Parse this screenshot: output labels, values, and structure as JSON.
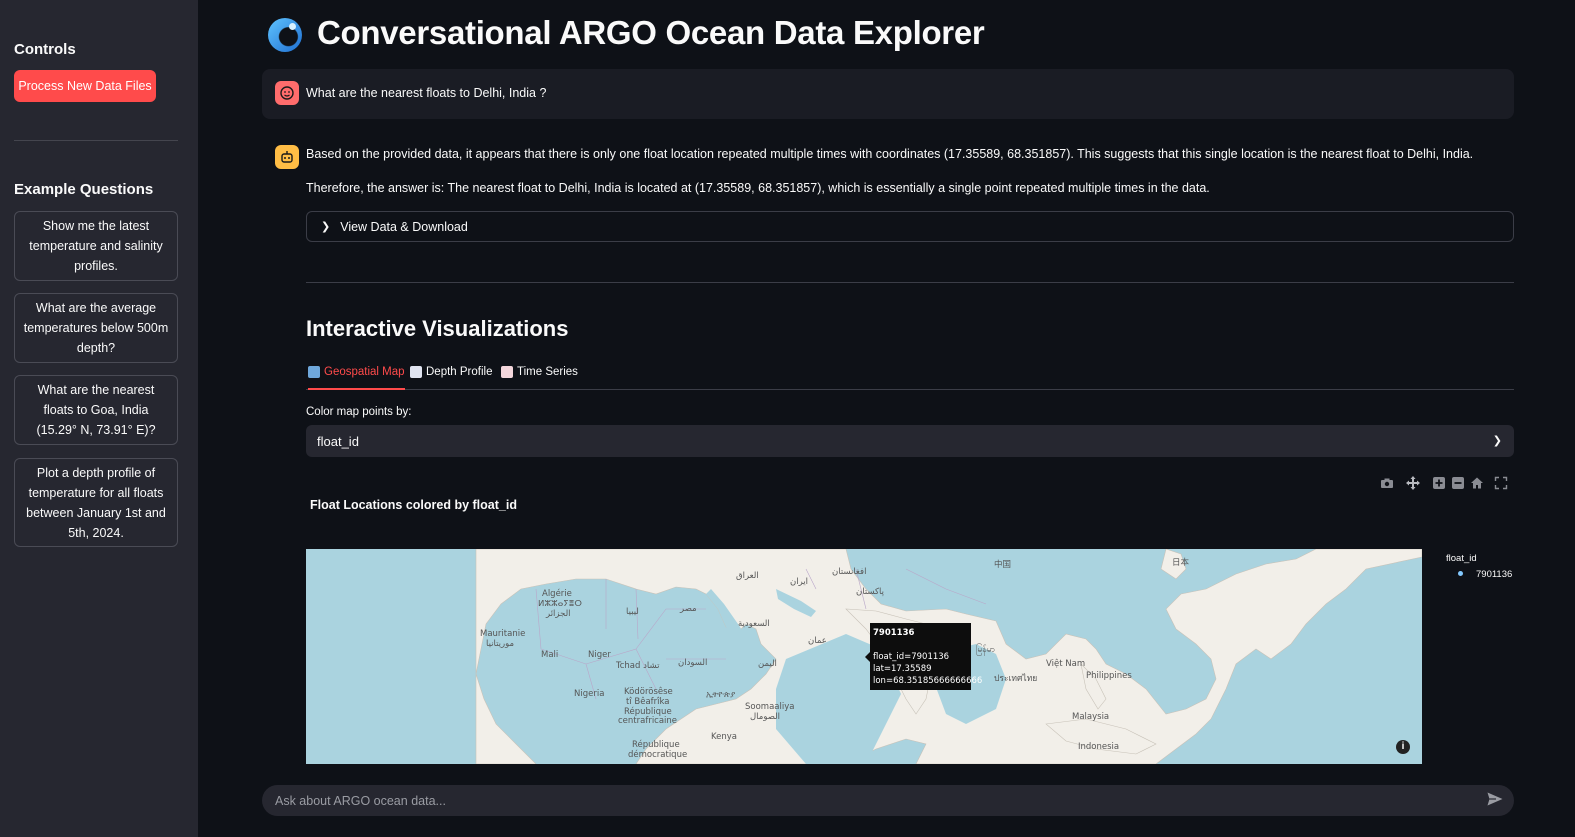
{
  "sidebar": {
    "controls_title": "Controls",
    "process_button": "Process New Data Files",
    "examples_title": "Example Questions",
    "examples": [
      "Show me the latest temperature and salinity profiles.",
      "What are the average temperatures below 500m depth?",
      "What are the nearest floats to Goa, India (15.29° N, 73.91° E)?",
      "Plot a depth profile of temperature for all floats between January 1st and 5th, 2024."
    ]
  },
  "header": {
    "icon": "ocean-wave-icon",
    "title": "Conversational ARGO Ocean Data Explorer"
  },
  "chat": {
    "user_message": "What are the nearest floats to Delhi, India ?",
    "assistant_line1": "Based on the provided data, it appears that there is only one float location repeated multiple times with coordinates (17.35589, 68.351857). This suggests that this single location is the nearest float to Delhi, India.",
    "assistant_line2": "Therefore, the answer is: The nearest float to Delhi, India is located at (17.35589, 68.351857), which is essentially a single point repeated multiple times in the data.",
    "expander_label": "View Data & Download"
  },
  "visualizations": {
    "title": "Interactive Visualizations",
    "tabs": [
      "Geospatial Map",
      "Depth Profile",
      "Time Series"
    ],
    "active_tab": 0,
    "color_label": "Color map points by:",
    "color_selected": "float_id",
    "chart_title": "Float Locations colored by float_id",
    "legend_title": "float_id",
    "legend_item": "7901136",
    "legend_color": "#83c9ff",
    "map_labels": [
      "Algérie",
      "ⵍⵣⵣⴰⵢⴻⵔ",
      "الجزائر",
      "ليبيا",
      "مصر",
      "العراق",
      "ایران",
      "افغانستان",
      "پاکستان",
      "中国",
      "日本",
      "السعودية",
      "عمان",
      "اليمن",
      "السودان",
      "Tchad تشاد",
      "Niger",
      "Mali",
      "Mauritanie",
      "موريتانيا",
      "Nigeria",
      "Ködörösêse",
      "tî Bêafrîka",
      "République",
      "centrafricaine",
      "ኢትዮጵያ",
      "Soomaaliya",
      "الصومال",
      "Kenya",
      "République",
      "démocratique",
      "မြန်မာ",
      "Việt Nam",
      "ประเทศไทย",
      "Philippines",
      "Malaysia",
      "Indonesia"
    ],
    "tooltip": {
      "title": "7901136",
      "line1": "float_id=7901136",
      "line2": "lat=17.35589",
      "line3": "lon=68.35185666666666"
    },
    "modebar": [
      "camera-icon",
      "pan-icon",
      "zoom-in-icon",
      "zoom-out-icon",
      "home-icon",
      "fullscreen-icon"
    ]
  },
  "input": {
    "placeholder": "Ask about ARGO ocean data..."
  },
  "colors": {
    "accent": "#ff4b4b",
    "background": "#0e1117",
    "sidebar": "#262730",
    "ocean": "#aad3df",
    "land": "#f2efe9"
  }
}
